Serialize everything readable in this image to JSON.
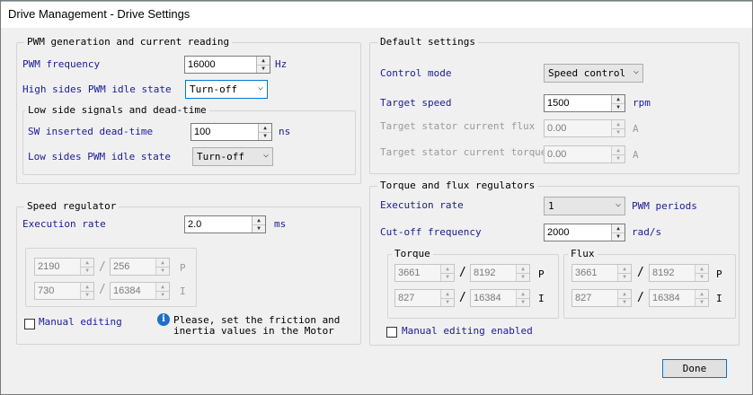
{
  "window": {
    "title": "Drive Management - Drive Settings"
  },
  "pwm": {
    "title": "PWM generation and current reading",
    "freq_label": "PWM frequency",
    "freq_value": "16000",
    "freq_unit": "Hz",
    "high_label": "High sides PWM idle state",
    "high_value": "Turn-off",
    "low_group_title": "Low side signals and dead-time",
    "dead_label": "SW inserted dead-time",
    "dead_value": "100",
    "dead_unit": "ns",
    "low_label": "Low sides PWM idle state",
    "low_value": "Turn-off"
  },
  "default": {
    "title": "Default settings",
    "mode_label": "Control mode",
    "mode_value": "Speed control",
    "speed_label": "Target speed",
    "speed_value": "1500",
    "speed_unit": "rpm",
    "flux_label": "Target stator current flux",
    "flux_value": "0.00",
    "flux_unit": "A",
    "torque_label": "Target stator current torque",
    "torque_value": "0.00",
    "torque_unit": "A"
  },
  "speed_reg": {
    "title": "Speed regulator",
    "rate_label": "Execution rate",
    "rate_value": "2.0",
    "rate_unit": "ms",
    "p_num": "2190",
    "p_den": "256",
    "p_label": "P",
    "i_num": "730",
    "i_den": "16384",
    "i_label": "I",
    "slash": "/",
    "manual_label": "Manual editing",
    "info_icon": "i",
    "info_text_1": "Please, set the friction and",
    "info_text_2": "inertia values in the Motor"
  },
  "tf_reg": {
    "title": "Torque and flux regulators",
    "rate_label": "Execution rate",
    "rate_value": "1",
    "rate_unit": "PWM periods",
    "cutoff_label": "Cut-off frequency",
    "cutoff_value": "2000",
    "cutoff_unit": "rad/s",
    "torque_title": "Torque",
    "torque_p_num": "3661",
    "torque_p_den": "8192",
    "torque_i_num": "827",
    "torque_i_den": "16384",
    "flux_title": "Flux",
    "flux_p_num": "3661",
    "flux_p_den": "8192",
    "flux_i_num": "827",
    "flux_i_den": "16384",
    "p_label": "P",
    "i_label": "I",
    "manual_label": "Manual editing enabled"
  },
  "done_label": "Done",
  "spin_up_glyph": "▲",
  "spin_down_glyph": "▼",
  "combo_arrow_glyph": "⌵",
  "colors": {
    "label_blue": "#1a1a9a",
    "focus_border": "#0078d7",
    "info_blue": "#1e6fc8"
  }
}
